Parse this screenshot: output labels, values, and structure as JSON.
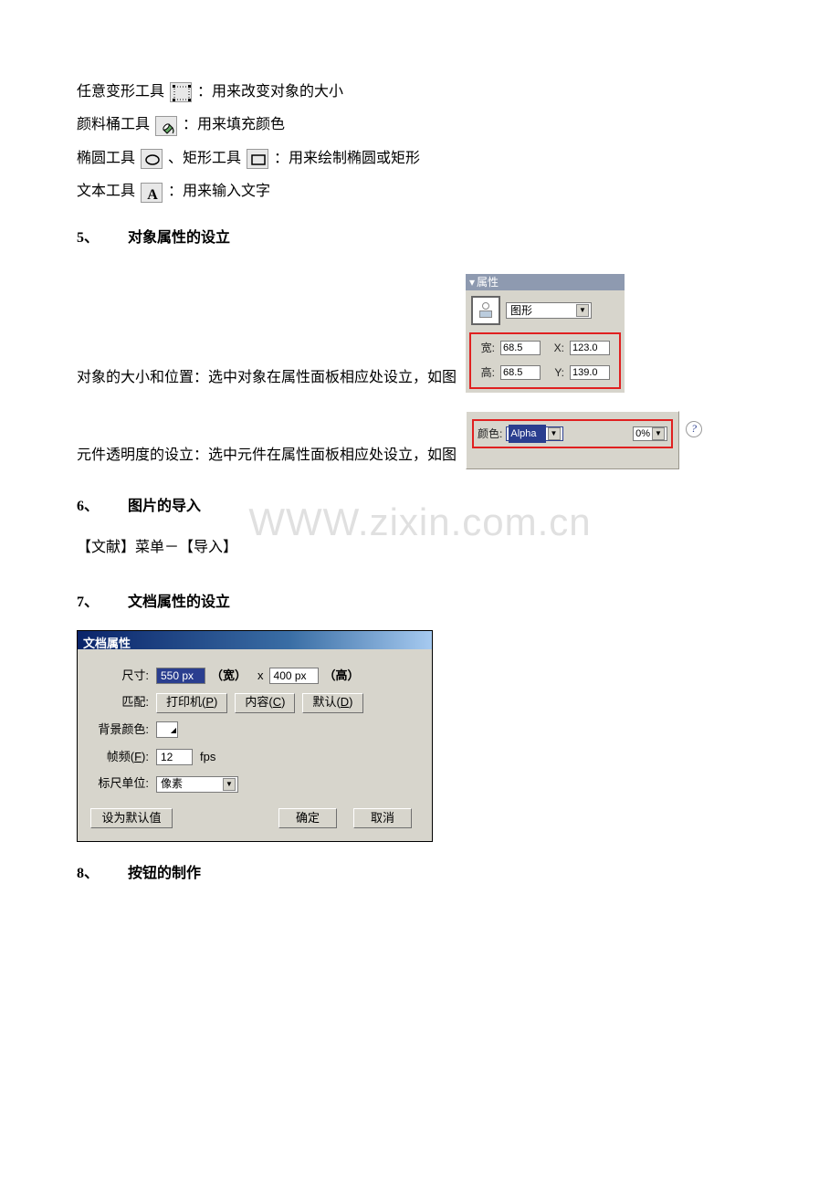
{
  "lines": {
    "transform_before": "任意变形工具",
    "transform_after": "：用来改变对象的大小",
    "bucket_before": "颜料桶工具",
    "bucket_after": "：用来填充颜色",
    "oval_before": "椭圆工具",
    "rect_sep": "、矩形工具",
    "oval_after": "：用来绘制椭圆或矩形",
    "text_before": "文本工具",
    "text_after": "：用来输入文字"
  },
  "sections": {
    "s5_num": "5、",
    "s5_title": "对象属性的设立",
    "s5_line1": "对象的大小和位置：选中对象在属性面板相应处设立，如图",
    "s5_line2": "元件透明度的设立：选中元件在属性面板相应处设立，如图",
    "s6_num": "6、",
    "s6_title": "图片的导入",
    "s6_body": "【文献】菜单－【导入】",
    "s7_num": "7、",
    "s7_title": "文档属性的设立",
    "s8_num": "8、",
    "s8_title": "按钮的制作"
  },
  "properties_panel": {
    "title": "属性",
    "dropdown_value": "图形",
    "w_label": "宽:",
    "w_value": "68.5",
    "h_label": "高:",
    "h_value": "68.5",
    "x_label": "X:",
    "x_value": "123.0",
    "y_label": "Y:",
    "y_value": "139.0"
  },
  "alpha_panel": {
    "color_label": "颜色:",
    "mode": "Alpha",
    "percent": "0%"
  },
  "doc_dialog": {
    "title": "文档属性",
    "size_label": "尺寸:",
    "width_value": "550 px",
    "width_paren": "（宽）",
    "times": "x",
    "height_value": "400 px",
    "height_paren": "（高）",
    "match_label": "匹配:",
    "printer_btn": "打印机(P)",
    "printer_u": "P",
    "content_btn": "内容(C)",
    "content_u": "C",
    "default_btn": "默认(D)",
    "default_u": "D",
    "bg_label": "背景颜色:",
    "fps_label": "帧频(F):",
    "fps_u": "F",
    "fps_value": "12",
    "fps_unit": "fps",
    "ruler_label": "标尺单位:",
    "ruler_value": "像素",
    "set_default": "设为默认值",
    "ok": "确定",
    "cancel": "取消"
  },
  "watermark": "WWW.zixin.com.cn"
}
